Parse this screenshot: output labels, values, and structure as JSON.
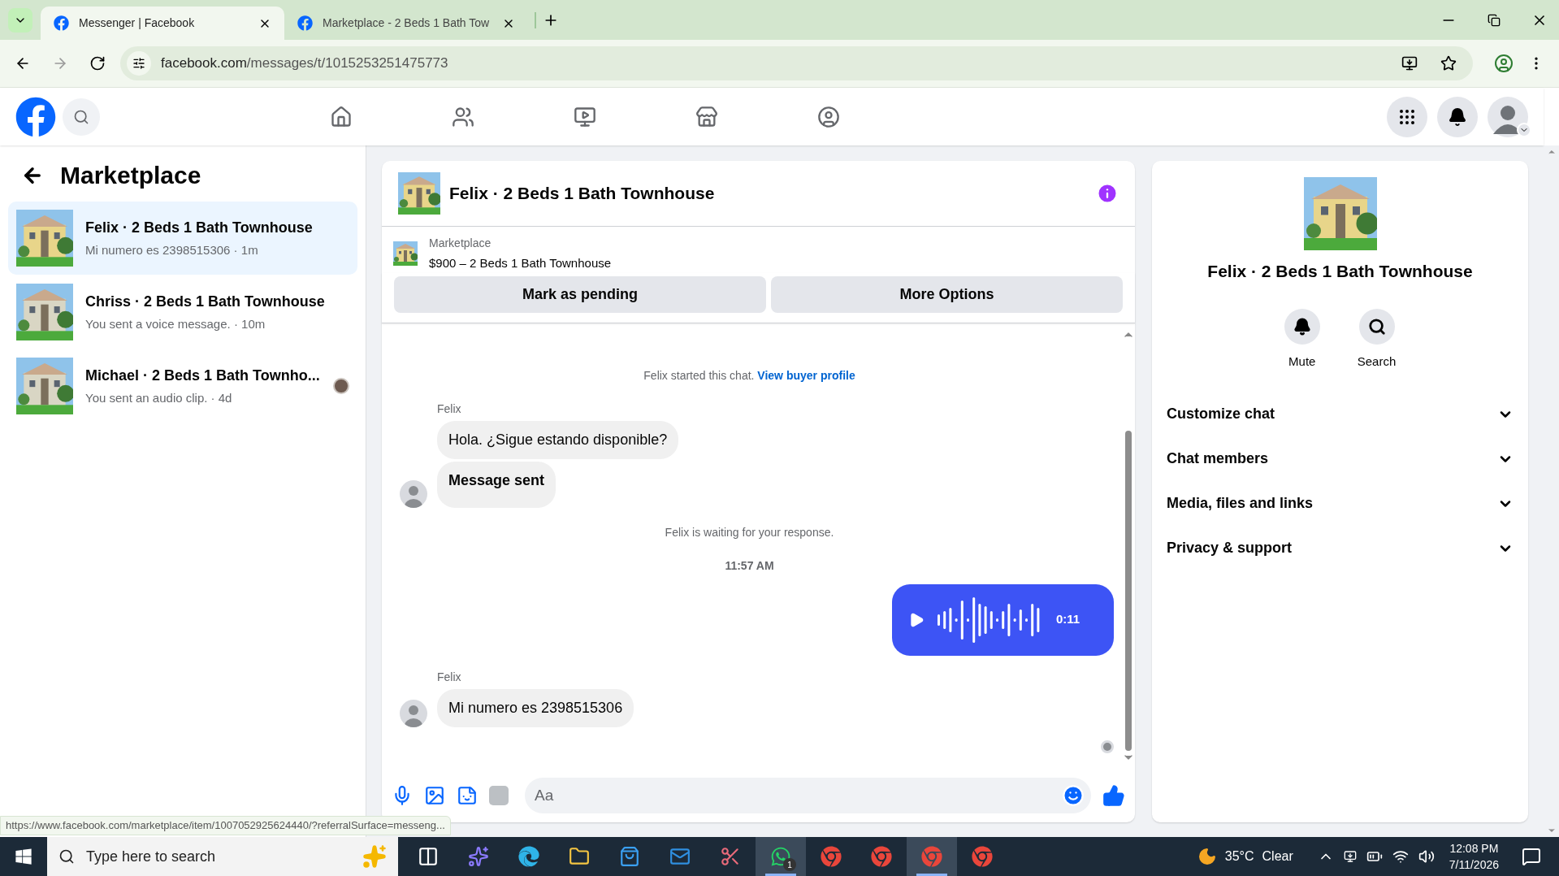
{
  "browser": {
    "tabs": [
      {
        "title": "Messenger | Facebook",
        "selected": true
      },
      {
        "title": "Marketplace - 2 Beds 1 Bath Tow",
        "selected": false
      }
    ],
    "url_host": "facebook.com",
    "url_path": "/messages/t/1015253251475773"
  },
  "nav": [
    {
      "selected": false
    },
    {
      "selected": false
    },
    {
      "selected": false
    },
    {
      "selected": false
    },
    {
      "selected": false
    }
  ],
  "sidebar": {
    "title": "Marketplace",
    "chats": [
      {
        "title": "Felix · 2 Beds 1 Bath Townhouse",
        "preview": "Mi numero es 2398515306 · 1m",
        "selected": true,
        "seen_avatar": false
      },
      {
        "title": "Chriss · 2 Beds 1 Bath Townhouse",
        "preview": "You sent a voice message. · 10m",
        "selected": false,
        "seen_avatar": false
      },
      {
        "title": "Michael · 2 Beds 1 Bath Townho...",
        "preview": "You sent an audio clip. · 4d",
        "selected": false,
        "seen_avatar": true
      }
    ]
  },
  "chat": {
    "title": "Felix · 2 Beds 1 Bath Townhouse",
    "listing_label": "Marketplace",
    "listing_title": "$900 – 2 Beds 1 Bath Townhouse",
    "actions": [
      "Mark as pending",
      "More Options"
    ],
    "messages": [
      {
        "kind": "notice",
        "text": "Felix started this chat.",
        "link": "View buyer profile"
      },
      {
        "kind": "group",
        "sender": "Felix",
        "bubbles": [
          {
            "text": "Hola. ¿Sigue estando disponible?",
            "bold": false
          },
          {
            "text": "Message sent",
            "bold": true
          }
        ]
      },
      {
        "kind": "notice",
        "text": "Felix is waiting for your response."
      },
      {
        "kind": "time",
        "text": "11:57 AM"
      },
      {
        "kind": "audio",
        "duration": "0:11"
      },
      {
        "kind": "group",
        "sender": "Felix",
        "bubbles": [
          {
            "text": "Mi numero es 2398515306",
            "bold": false
          }
        ]
      }
    ],
    "composer": {
      "placeholder": "Aa"
    }
  },
  "details": {
    "title": "Felix · 2 Beds 1 Bath Townhouse",
    "actions": [
      {
        "label": "Mute"
      },
      {
        "label": "Search"
      }
    ],
    "sections": [
      {
        "label": "Customize chat",
        "expanded": false
      },
      {
        "label": "Chat members",
        "expanded": false
      },
      {
        "label": "Media, files and links",
        "expanded": false
      },
      {
        "label": "Privacy & support",
        "expanded": false
      }
    ]
  },
  "status_link": "https://www.facebook.com/marketplace/item/1007052925624440/?referralSurface=messeng...",
  "taskbar": {
    "search_placeholder": "Type here to search",
    "apps": [
      {
        "active": false
      },
      {
        "active": false
      },
      {
        "active": false
      },
      {
        "active": false
      },
      {
        "active": false
      },
      {
        "active": false
      },
      {
        "active": false
      },
      {
        "active": true,
        "badge": "1"
      },
      {
        "active": false
      },
      {
        "active": false
      },
      {
        "active": true
      },
      {
        "active": false
      }
    ],
    "weather": "35°C",
    "weather_text": "Clear",
    "time": "12:08 PM",
    "date": "7/11/2026"
  }
}
